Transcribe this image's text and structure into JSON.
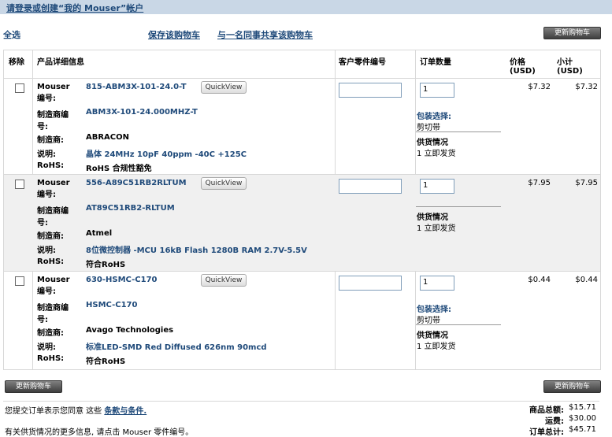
{
  "header": {
    "title": "请登录或创建“我的 Mouser”帐户"
  },
  "toolbar": {
    "select_all": "全选",
    "save_cart": "保存该购物车",
    "share_cart": "与一名同事共享该购物车",
    "update_cart": "更新购物车"
  },
  "columns": {
    "remove": "移除",
    "details": "产品详细信息",
    "customer_part": "客户零件编号",
    "order_qty": "订单数量",
    "price": "价格 (USD)",
    "subtotal": "小计 (USD)"
  },
  "labels": {
    "mouser_no": "Mouser 编号:",
    "mfr_no": "制造商编号:",
    "mfr": "制造商:",
    "desc": "说明:",
    "rohs": "RoHS:",
    "quickview": "QuickView",
    "packaging": "包装选择:",
    "availability": "供货情况"
  },
  "items": [
    {
      "mouser_no": "815-ABM3X-101-24.0-T",
      "mfr_no": "ABM3X-101-24.000MHZ-T",
      "mfr": "ABRACON",
      "desc": "晶体 24MHz 10pF 40ppm -40C +125C",
      "rohs": "RoHS 合规性豁免",
      "qty": "1",
      "packaging": "剪切带",
      "availability": "1 立即发货",
      "price": "$7.32",
      "subtotal": "$7.32"
    },
    {
      "mouser_no": "556-A89C51RB2RLTUM",
      "mfr_no": "AT89C51RB2-RLTUM",
      "mfr": "Atmel",
      "desc": "8位微控制器 -MCU 16kB Flash 1280B RAM 2.7V-5.5V",
      "rohs": "符合RoHS",
      "qty": "1",
      "packaging": "",
      "availability": "1 立即发货",
      "price": "$7.95",
      "subtotal": "$7.95"
    },
    {
      "mouser_no": "630-HSMC-C170",
      "mfr_no": "HSMC-C170",
      "mfr": "Avago Technologies",
      "desc": "标准LED-SMD Red Diffused 626nm 90mcd",
      "rohs": "符合RoHS",
      "qty": "1",
      "packaging": "剪切带",
      "availability": "1 立即发货",
      "price": "$0.44",
      "subtotal": "$0.44"
    }
  ],
  "footer": {
    "terms_prefix": "您提交订单表示您同意 这些",
    "terms_link": "条款与条件.",
    "more_info": "有关供货情况的更多信息, 请点击 Mouser 零件编号。",
    "merch_total_label": "商品总额:",
    "merch_total": "$15.71",
    "shipping_label": "运费:",
    "shipping": "$30.00",
    "order_total_label": "订单总计:",
    "order_total": "$45.71"
  }
}
